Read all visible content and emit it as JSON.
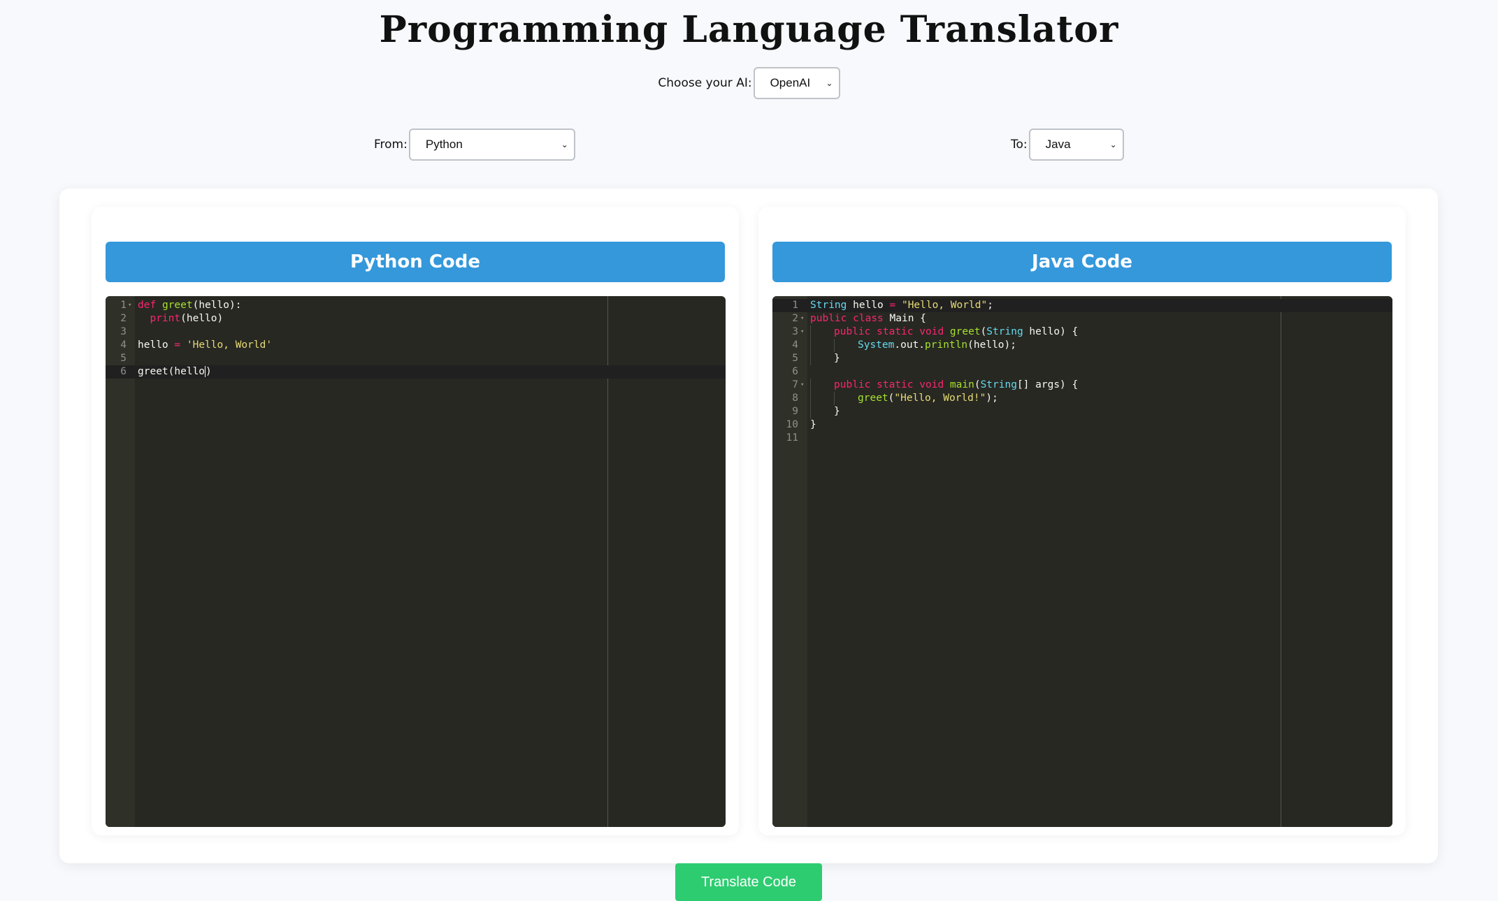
{
  "header": {
    "title": "Programming Language Translator"
  },
  "ai_selector": {
    "label": "Choose your AI:",
    "value": "OpenAI"
  },
  "from_selector": {
    "label": "From:",
    "value": "Python"
  },
  "to_selector": {
    "label": "To:",
    "value": "Java"
  },
  "left_panel": {
    "title": "Python Code",
    "lines": [
      {
        "num": "1",
        "fold": "▾",
        "tokens": [
          {
            "t": "def",
            "c": "kw"
          },
          {
            "t": " ",
            "c": ""
          },
          {
            "t": "greet",
            "c": "fn"
          },
          {
            "t": "(hello):",
            "c": ""
          }
        ]
      },
      {
        "num": "2",
        "fold": "",
        "tokens": [
          {
            "t": "  ",
            "c": ""
          },
          {
            "t": "print",
            "c": "kw"
          },
          {
            "t": "(hello)",
            "c": ""
          }
        ]
      },
      {
        "num": "3",
        "fold": "",
        "tokens": []
      },
      {
        "num": "4",
        "fold": "",
        "tokens": [
          {
            "t": "hello ",
            "c": ""
          },
          {
            "t": "=",
            "c": "kw"
          },
          {
            "t": " ",
            "c": ""
          },
          {
            "t": "'Hello, World'",
            "c": "str"
          }
        ]
      },
      {
        "num": "5",
        "fold": "",
        "tokens": []
      },
      {
        "num": "6",
        "fold": "",
        "active": true,
        "tokens": [
          {
            "t": "greet(hello",
            "c": ""
          },
          {
            "t": "|",
            "c": "cursor"
          },
          {
            "t": ")",
            "c": ""
          }
        ]
      }
    ]
  },
  "right_panel": {
    "title": "Java Code",
    "lines": [
      {
        "num": "1",
        "fold": "",
        "active": true,
        "tokens": [
          {
            "t": "String",
            "c": "typ"
          },
          {
            "t": " hello ",
            "c": ""
          },
          {
            "t": "=",
            "c": "kw"
          },
          {
            "t": " ",
            "c": ""
          },
          {
            "t": "\"Hello, World\"",
            "c": "str"
          },
          {
            "t": ";",
            "c": ""
          }
        ]
      },
      {
        "num": "2",
        "fold": "▾",
        "tokens": [
          {
            "t": "public",
            "c": "kw"
          },
          {
            "t": " ",
            "c": ""
          },
          {
            "t": "class",
            "c": "kw"
          },
          {
            "t": " Main {",
            "c": ""
          }
        ]
      },
      {
        "num": "3",
        "fold": "▾",
        "tokens": [
          {
            "t": "G",
            "c": "guide"
          },
          {
            "t": "public",
            "c": "kw"
          },
          {
            "t": " ",
            "c": ""
          },
          {
            "t": "static",
            "c": "kw"
          },
          {
            "t": " ",
            "c": ""
          },
          {
            "t": "void",
            "c": "kw"
          },
          {
            "t": " ",
            "c": ""
          },
          {
            "t": "greet",
            "c": "fn"
          },
          {
            "t": "(",
            "c": ""
          },
          {
            "t": "String",
            "c": "typ"
          },
          {
            "t": " hello) {",
            "c": ""
          }
        ]
      },
      {
        "num": "4",
        "fold": "",
        "tokens": [
          {
            "t": "G",
            "c": "guide"
          },
          {
            "t": "G",
            "c": "guide"
          },
          {
            "t": "System",
            "c": "typ"
          },
          {
            "t": ".out.",
            "c": ""
          },
          {
            "t": "println",
            "c": "fn"
          },
          {
            "t": "(hello);",
            "c": ""
          }
        ]
      },
      {
        "num": "5",
        "fold": "",
        "tokens": [
          {
            "t": "G",
            "c": "guide"
          },
          {
            "t": "}",
            "c": ""
          }
        ]
      },
      {
        "num": "6",
        "fold": "",
        "tokens": []
      },
      {
        "num": "7",
        "fold": "▾",
        "tokens": [
          {
            "t": "G",
            "c": "guide"
          },
          {
            "t": "public",
            "c": "kw"
          },
          {
            "t": " ",
            "c": ""
          },
          {
            "t": "static",
            "c": "kw"
          },
          {
            "t": " ",
            "c": ""
          },
          {
            "t": "void",
            "c": "kw"
          },
          {
            "t": " ",
            "c": ""
          },
          {
            "t": "main",
            "c": "fn"
          },
          {
            "t": "(",
            "c": ""
          },
          {
            "t": "String",
            "c": "typ"
          },
          {
            "t": "[] args) {",
            "c": ""
          }
        ]
      },
      {
        "num": "8",
        "fold": "",
        "tokens": [
          {
            "t": "G",
            "c": "guide"
          },
          {
            "t": "G",
            "c": "guide"
          },
          {
            "t": "greet",
            "c": "fn"
          },
          {
            "t": "(",
            "c": ""
          },
          {
            "t": "\"Hello, World!\"",
            "c": "str"
          },
          {
            "t": ");",
            "c": ""
          }
        ]
      },
      {
        "num": "9",
        "fold": "",
        "tokens": [
          {
            "t": "G",
            "c": "guide"
          },
          {
            "t": "}",
            "c": ""
          }
        ]
      },
      {
        "num": "10",
        "fold": "",
        "tokens": [
          {
            "t": "}",
            "c": ""
          }
        ]
      },
      {
        "num": "11",
        "fold": "",
        "tokens": []
      }
    ]
  },
  "actions": {
    "translate_label": "Translate Code"
  },
  "colors": {
    "header_blue": "#3498db",
    "button_green": "#2ecc71",
    "editor_bg": "#272822"
  }
}
